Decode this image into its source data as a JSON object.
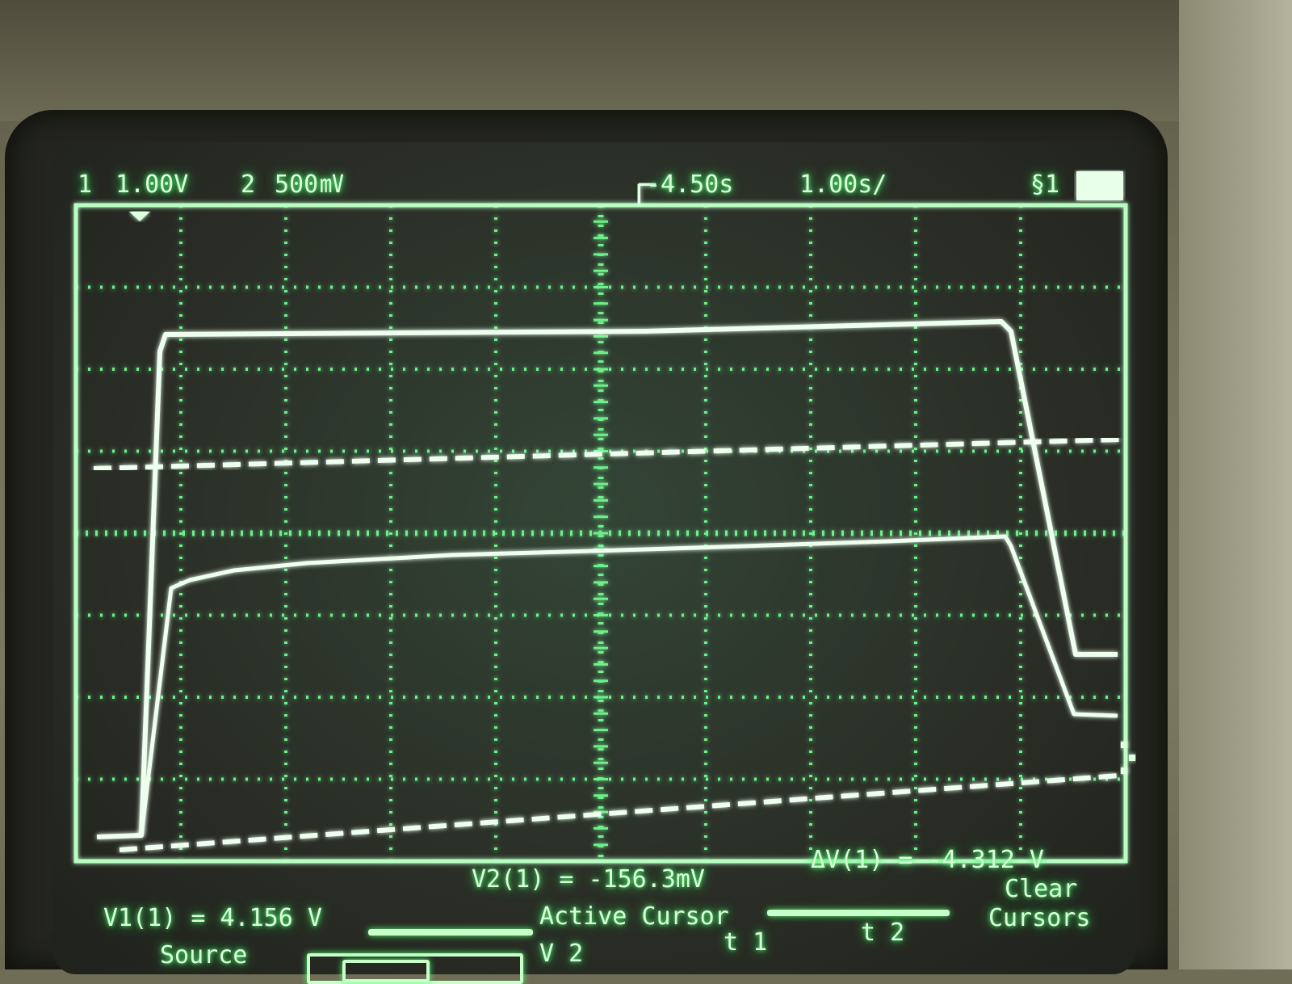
{
  "top_bar": {
    "ch1_label": "1",
    "ch1_scale": "1.00V",
    "ch2_label": "2",
    "ch2_scale": "500",
    "ch2_unit_icon": "mv-unit-icon",
    "delay": "-4.50s",
    "timebase": "1.00s/",
    "trigger_src": "§1",
    "trigger_icon": "trigger-slope-icon"
  },
  "cursors": {
    "v1": "V1(1) = 4.156 V",
    "v2": "V2(1) = -156.3mV",
    "dv": "ΔV(1) = -4.312 V"
  },
  "softkeys": {
    "source": "Source",
    "active_cursor": "Active Cursor",
    "v2": "V 2",
    "t1": "t 1",
    "t2": "t 2",
    "clear": "Clear",
    "cursors": "Cursors"
  },
  "colors": {
    "trace": "#e8ffe9",
    "grid": "#6df08a",
    "glow": "#3ee35f"
  }
}
